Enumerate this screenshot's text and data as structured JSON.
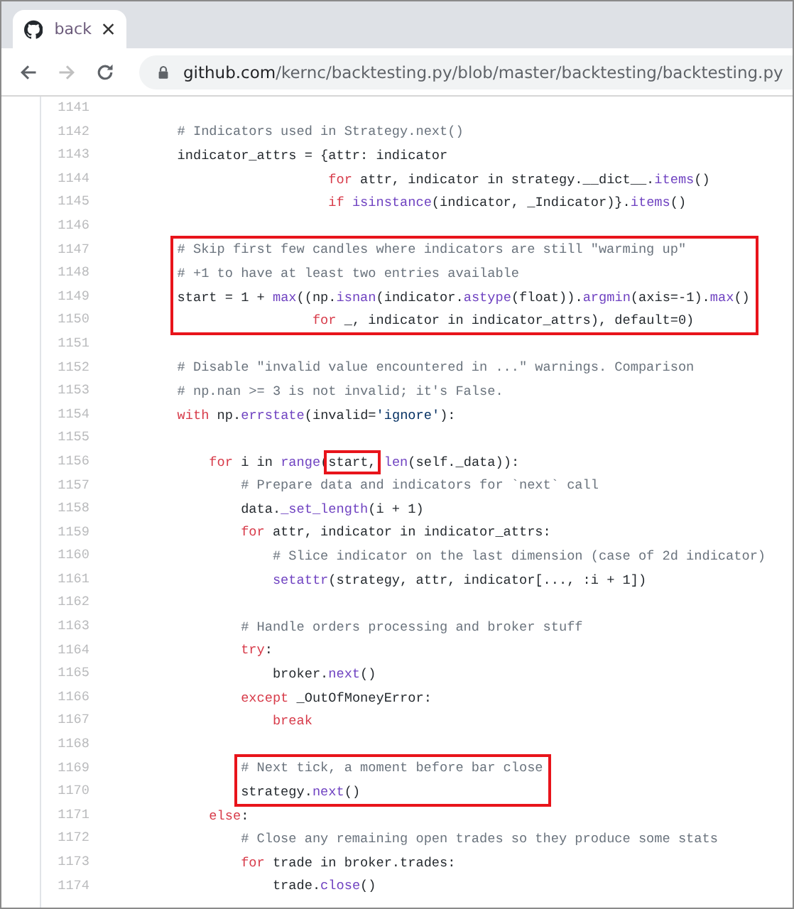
{
  "browser": {
    "tab": {
      "title": "back",
      "selected": true
    },
    "nav": [
      {
        "kind": "back",
        "disabled": false
      },
      {
        "kind": "forward",
        "disabled": true
      },
      {
        "kind": "reload",
        "disabled": false
      }
    ],
    "url": {
      "host": "github.com",
      "path": "/kernc/backtesting.py/blob/master/backtesting/backtesting.py"
    }
  },
  "code": {
    "lines": [
      {
        "number": "1141",
        "boxed": false
      },
      {
        "number": "1142",
        "boxed": false,
        "segments": [
          {
            "kind": "comment",
            "text": "        # Indicators used in Strategy.next()"
          }
        ]
      },
      {
        "number": "1143",
        "boxed": false,
        "segments": [
          {
            "kind": "plain",
            "text": "        indicator_attrs = {attr: indicator"
          }
        ]
      },
      {
        "number": "1144",
        "boxed": false,
        "segments": [
          {
            "kind": "keyword",
            "text": "                           for"
          },
          {
            "kind": "plain",
            "text": " attr, indicator in strategy.__dict__."
          },
          {
            "kind": "function",
            "text": "items"
          },
          {
            "kind": "plain",
            "text": "()"
          }
        ]
      },
      {
        "number": "1145",
        "boxed": false,
        "segments": [
          {
            "kind": "keyword",
            "text": "                           if "
          },
          {
            "kind": "function",
            "text": "isinstance"
          },
          {
            "kind": "plain",
            "text": "(indicator, _Indicator)}."
          },
          {
            "kind": "function",
            "text": "items"
          },
          {
            "kind": "plain",
            "text": "()"
          }
        ]
      },
      {
        "number": "1146",
        "boxed": false
      },
      {
        "number": "1147",
        "boxed": true,
        "segments": [
          {
            "kind": "comment",
            "text": "        # Skip first few candles where indicators are still \"warming up\""
          }
        ]
      },
      {
        "number": "1148",
        "boxed": true,
        "segments": [
          {
            "kind": "comment",
            "text": "        # +1 to have at least two entries available"
          }
        ]
      },
      {
        "number": "1149",
        "boxed": true,
        "segments": [
          {
            "kind": "plain",
            "text": "        start = 1 + "
          },
          {
            "kind": "function",
            "text": "max"
          },
          {
            "kind": "plain",
            "text": "((np."
          },
          {
            "kind": "function",
            "text": "isnan"
          },
          {
            "kind": "plain",
            "text": "(indicator."
          },
          {
            "kind": "function",
            "text": "astype"
          },
          {
            "kind": "plain",
            "text": "(float))."
          },
          {
            "kind": "function",
            "text": "argmin"
          },
          {
            "kind": "plain",
            "text": "(axis=-1)."
          },
          {
            "kind": "function",
            "text": "max"
          },
          {
            "kind": "plain",
            "text": "()"
          }
        ]
      },
      {
        "number": "1150",
        "boxed": true,
        "segments": [
          {
            "kind": "keyword",
            "text": "                         for"
          },
          {
            "kind": "plain",
            "text": " _, indicator in indicator_attrs), default=0)"
          }
        ]
      },
      {
        "number": "1151",
        "boxed": false
      },
      {
        "number": "1152",
        "boxed": false,
        "segments": [
          {
            "kind": "comment",
            "text": "        # Disable \"invalid value encountered in ...\" warnings. Comparison"
          }
        ]
      },
      {
        "number": "1153",
        "boxed": false,
        "segments": [
          {
            "kind": "comment",
            "text": "        # np.nan >= 3 is not invalid; it's False."
          }
        ]
      },
      {
        "number": "1154",
        "boxed": false,
        "segments": [
          {
            "kind": "keyword",
            "text": "        with"
          },
          {
            "kind": "plain",
            "text": " np."
          },
          {
            "kind": "function",
            "text": "errstate"
          },
          {
            "kind": "plain",
            "text": "(invalid="
          },
          {
            "kind": "string",
            "text": "'ignore'"
          },
          {
            "kind": "plain",
            "text": "):"
          }
        ]
      },
      {
        "number": "1155",
        "boxed": false
      },
      {
        "number": "1156",
        "boxed": false,
        "segments": [
          {
            "kind": "keyword",
            "text": "            for"
          },
          {
            "kind": "plain",
            "text": " i in "
          },
          {
            "kind": "function",
            "text": "range"
          },
          {
            "kind": "plain",
            "text": "("
          },
          {
            "kind": "plain",
            "text": "start,",
            "boxed": true
          },
          {
            "kind": "function",
            "text": " len"
          },
          {
            "kind": "plain",
            "text": "(self._data)):"
          }
        ]
      },
      {
        "number": "1157",
        "boxed": false,
        "segments": [
          {
            "kind": "comment",
            "text": "                # Prepare data and indicators for `next` call"
          }
        ]
      },
      {
        "number": "1158",
        "boxed": false,
        "segments": [
          {
            "kind": "plain",
            "text": "                data."
          },
          {
            "kind": "function",
            "text": "_set_length"
          },
          {
            "kind": "plain",
            "text": "(i + 1)"
          }
        ]
      },
      {
        "number": "1159",
        "boxed": false,
        "segments": [
          {
            "kind": "keyword",
            "text": "                for"
          },
          {
            "kind": "plain",
            "text": " attr, indicator in indicator_attrs:"
          }
        ]
      },
      {
        "number": "1160",
        "boxed": false,
        "segments": [
          {
            "kind": "comment",
            "text": "                    # Slice indicator on the last dimension (case of 2d indicator)"
          }
        ]
      },
      {
        "number": "1161",
        "boxed": false,
        "segments": [
          {
            "kind": "function",
            "text": "                    setattr"
          },
          {
            "kind": "plain",
            "text": "(strategy, attr, indicator[..., :i + 1])"
          }
        ]
      },
      {
        "number": "1162",
        "boxed": false
      },
      {
        "number": "1163",
        "boxed": false,
        "segments": [
          {
            "kind": "comment",
            "text": "                # Handle orders processing and broker stuff"
          }
        ]
      },
      {
        "number": "1164",
        "boxed": false,
        "segments": [
          {
            "kind": "keyword",
            "text": "                try"
          },
          {
            "kind": "plain",
            "text": ":"
          }
        ]
      },
      {
        "number": "1165",
        "boxed": false,
        "segments": [
          {
            "kind": "plain",
            "text": "                    broker."
          },
          {
            "kind": "function",
            "text": "next"
          },
          {
            "kind": "plain",
            "text": "()"
          }
        ]
      },
      {
        "number": "1166",
        "boxed": false,
        "segments": [
          {
            "kind": "keyword",
            "text": "                except"
          },
          {
            "kind": "plain",
            "text": " _OutOfMoneyError:"
          }
        ]
      },
      {
        "number": "1167",
        "boxed": false,
        "segments": [
          {
            "kind": "keyword",
            "text": "                    break"
          }
        ]
      },
      {
        "number": "1168",
        "boxed": false
      },
      {
        "number": "1169",
        "boxed": true,
        "segments": [
          {
            "kind": "comment",
            "text": "                # Next tick, a moment before bar close"
          }
        ]
      },
      {
        "number": "1170",
        "boxed": true,
        "segments": [
          {
            "kind": "plain",
            "text": "                strategy."
          },
          {
            "kind": "function",
            "text": "next"
          },
          {
            "kind": "plain",
            "text": "()"
          }
        ]
      },
      {
        "number": "1171",
        "boxed": false,
        "segments": [
          {
            "kind": "keyword",
            "text": "            else"
          },
          {
            "kind": "plain",
            "text": ":"
          }
        ]
      },
      {
        "number": "1172",
        "boxed": false,
        "segments": [
          {
            "kind": "comment",
            "text": "                # Close any remaining open trades so they produce some stats"
          }
        ]
      },
      {
        "number": "1173",
        "boxed": false,
        "segments": [
          {
            "kind": "keyword",
            "text": "                for"
          },
          {
            "kind": "plain",
            "text": " trade in broker.trades:"
          }
        ]
      },
      {
        "number": "1174",
        "boxed": false,
        "segments": [
          {
            "kind": "plain",
            "text": "                    trade."
          },
          {
            "kind": "function",
            "text": "close"
          },
          {
            "kind": "plain",
            "text": "()"
          }
        ]
      }
    ]
  }
}
